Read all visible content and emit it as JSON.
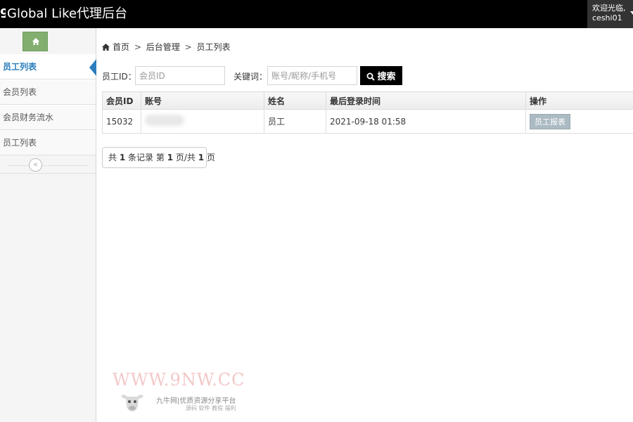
{
  "header": {
    "brand_text": "Global Like代理后台",
    "welcome": "欢迎光临,",
    "username": "ceshi01"
  },
  "sidebar": {
    "items": [
      {
        "label": "员工列表",
        "active": true
      },
      {
        "label": "会员列表",
        "active": false
      },
      {
        "label": "会员财务流水",
        "active": false
      },
      {
        "label": "员工列表",
        "active": false
      }
    ],
    "collapse_glyph": "«"
  },
  "breadcrumb": {
    "home": "首页",
    "level2": "后台管理",
    "level3": "员工列表",
    "sep": ">"
  },
  "search": {
    "id_label": "员工ID：",
    "id_placeholder": "会员ID",
    "keyword_label": "关键词：",
    "keyword_placeholder": "账号/昵称/手机号",
    "button_label": "搜索"
  },
  "table": {
    "headers": [
      "会员ID",
      "账号",
      "姓名",
      "最后登录时间",
      "操作"
    ],
    "rows": [
      {
        "member_id": "15032",
        "account": "",
        "name": "员工",
        "last_login": "2021-09-18 01:58",
        "action_label": "员工报表"
      }
    ]
  },
  "pager": {
    "prefix": "共",
    "total": "1",
    "mid1": "条记录 第",
    "page": "1",
    "mid2": "页/共",
    "pages": "1",
    "suffix": "页"
  },
  "watermark": {
    "title": "WWW.9NW.CC",
    "name": "九牛网|优质资源分享平台",
    "sub": "源码 软件 教程 福利"
  },
  "colors": {
    "topbar": "#000000",
    "home_button": "#82af6f",
    "active_menu": "#2b7dbc",
    "action_button": "#abbac3"
  }
}
